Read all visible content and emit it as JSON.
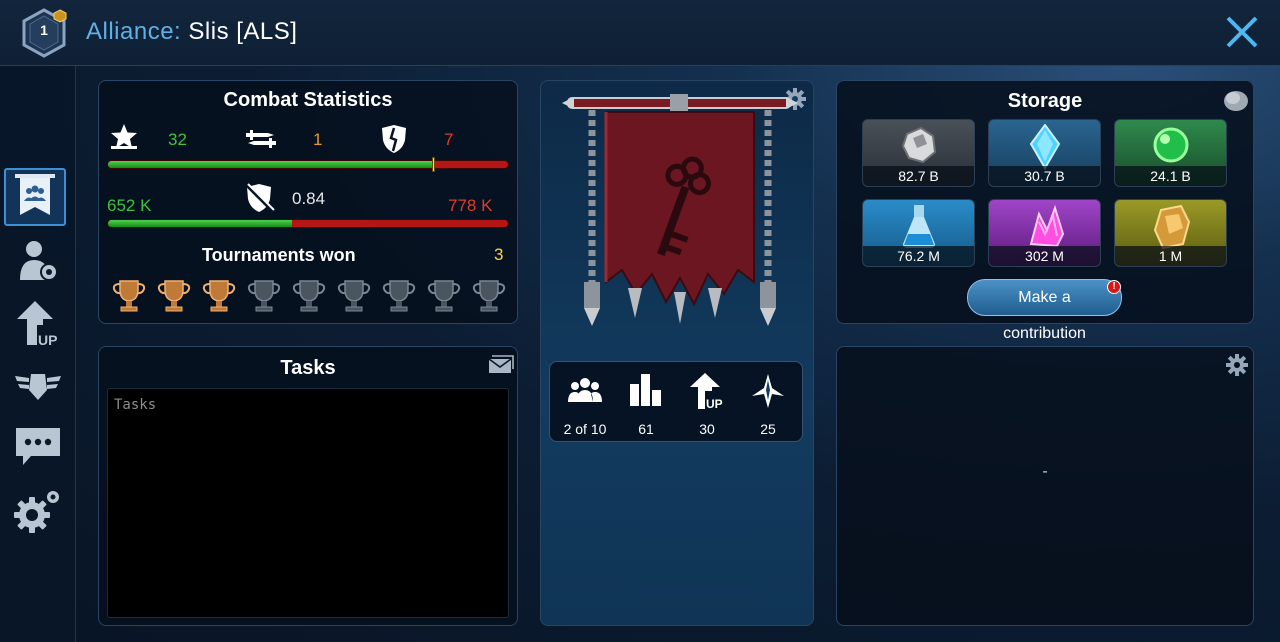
{
  "header": {
    "rank": "1",
    "title_label": "Alliance:",
    "title_value": "Slis [ALS]"
  },
  "sidebar": {
    "items": [
      {
        "icon": "alliance-banner-icon",
        "active": true
      },
      {
        "icon": "member-settings-icon",
        "active": false
      },
      {
        "icon": "upgrade-icon",
        "active": false
      },
      {
        "icon": "wings-emblem-icon",
        "active": false
      },
      {
        "icon": "chat-icon",
        "active": false
      },
      {
        "icon": "settings-icon",
        "active": false
      }
    ]
  },
  "combat": {
    "title": "Combat Statistics",
    "wins": "32",
    "draws": "1",
    "losses": "7",
    "win_fraction": 0.81,
    "left_power": "652 K",
    "ratio": "0.84",
    "right_power": "778 K",
    "power_fraction": 0.46,
    "tournaments_label": "Tournaments won",
    "tournaments_count": "3",
    "trophies_total": 9,
    "trophies_won": 3,
    "colors": {
      "win": "#3fc23f",
      "draw": "#e8962a",
      "loss": "#e23a2a",
      "count": "#ffd24a"
    }
  },
  "banner": {
    "emblem": "key-icon",
    "stats": [
      {
        "icon": "members-icon",
        "value": "2 of 10"
      },
      {
        "icon": "rating-bars-icon",
        "value": "61"
      },
      {
        "icon": "upgrade-up-icon",
        "value": "30"
      },
      {
        "icon": "rank-insignia-icon",
        "value": "25"
      }
    ]
  },
  "tasks": {
    "title": "Tasks",
    "placeholder": "Tasks"
  },
  "storage": {
    "title": "Storage",
    "resources": [
      {
        "icon": "metal-ore-icon",
        "value": "82.7 B",
        "color": "#e6e6e6"
      },
      {
        "icon": "crystal-icon",
        "value": "30.7 B",
        "color": "#55c6ff"
      },
      {
        "icon": "green-orb-icon",
        "value": "24.1 B",
        "color": "#c8f03a"
      },
      {
        "icon": "flask-icon",
        "value": "76.2 M",
        "color": "#55c6ff"
      },
      {
        "icon": "pink-crystal-icon",
        "value": "302 M",
        "color": "#f090ff"
      },
      {
        "icon": "gold-shard-icon",
        "value": "1 M",
        "color": "#ffe24a"
      }
    ],
    "contribute_button": "Make a",
    "contribute_caption": "contribution",
    "badge": "!"
  },
  "info_panel": {
    "text": "-"
  }
}
